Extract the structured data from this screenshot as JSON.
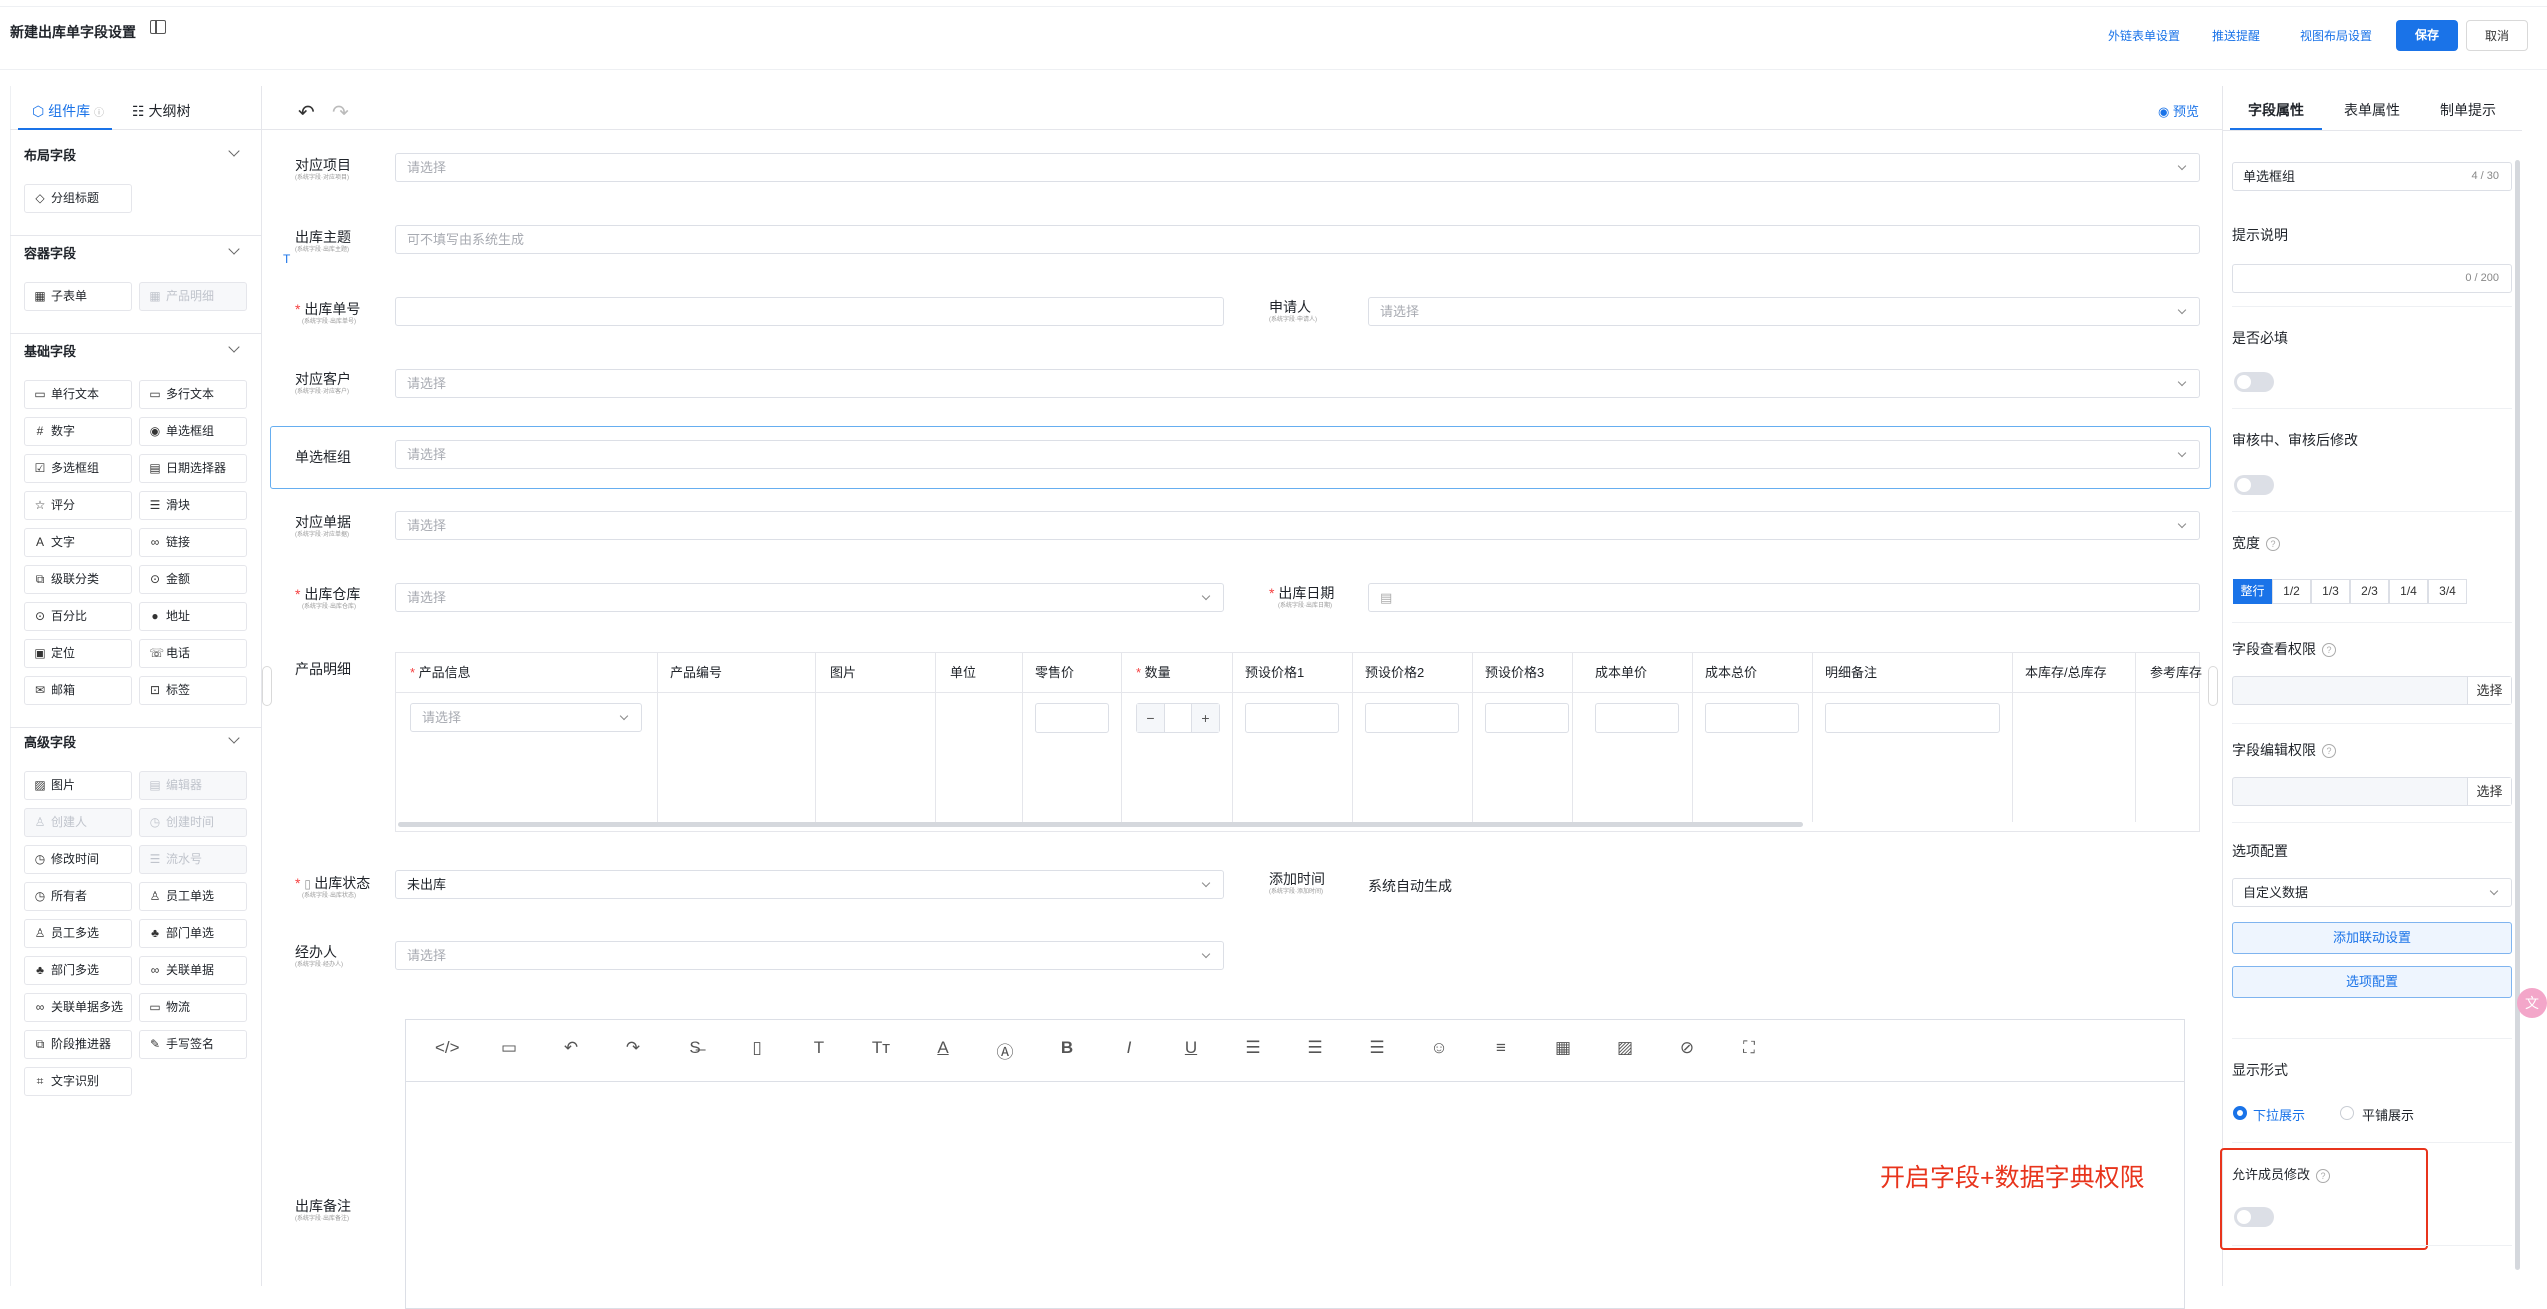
{
  "header": {
    "title": "新建出库单字段设置",
    "links": [
      "外链表单设置",
      "推送提醒",
      "视图布局设置"
    ],
    "save_label": "保存",
    "cancel_label": "取消"
  },
  "left_panel": {
    "tabs": [
      "组件库",
      "大纲树"
    ],
    "sections": [
      {
        "title": "布局字段",
        "items": [
          {
            "label": "分组标题",
            "icon": "◇",
            "disabled": false
          }
        ]
      },
      {
        "title": "容器字段",
        "items": [
          {
            "label": "子表单",
            "icon": "▦",
            "disabled": false
          },
          {
            "label": "产品明细",
            "icon": "▦",
            "disabled": true
          }
        ]
      },
      {
        "title": "基础字段",
        "items": [
          {
            "label": "单行文本",
            "icon": "▭",
            "disabled": false
          },
          {
            "label": "多行文本",
            "icon": "▭",
            "disabled": false
          },
          {
            "label": "数字",
            "icon": "#",
            "disabled": false
          },
          {
            "label": "单选框组",
            "icon": "◉",
            "disabled": false
          },
          {
            "label": "多选框组",
            "icon": "☑",
            "disabled": false
          },
          {
            "label": "日期选择器",
            "icon": "▤",
            "disabled": false
          },
          {
            "label": "评分",
            "icon": "☆",
            "disabled": false
          },
          {
            "label": "滑块",
            "icon": "☰",
            "disabled": false
          },
          {
            "label": "文字",
            "icon": "A",
            "disabled": false
          },
          {
            "label": "链接",
            "icon": "∞",
            "disabled": false
          },
          {
            "label": "级联分类",
            "icon": "⧉",
            "disabled": false
          },
          {
            "label": "金额",
            "icon": "⊙",
            "disabled": false
          },
          {
            "label": "百分比",
            "icon": "⊙",
            "disabled": false
          },
          {
            "label": "地址",
            "icon": "●",
            "disabled": false
          },
          {
            "label": "定位",
            "icon": "▣",
            "disabled": false
          },
          {
            "label": "电话",
            "icon": "☏",
            "disabled": false
          },
          {
            "label": "邮箱",
            "icon": "✉",
            "disabled": false
          },
          {
            "label": "标签",
            "icon": "⊡",
            "disabled": false
          }
        ]
      },
      {
        "title": "高级字段",
        "items": [
          {
            "label": "图片",
            "icon": "▨",
            "disabled": false
          },
          {
            "label": "编辑器",
            "icon": "▤",
            "disabled": true
          },
          {
            "label": "创建人",
            "icon": "♙",
            "disabled": true
          },
          {
            "label": "创建时间",
            "icon": "◷",
            "disabled": true
          },
          {
            "label": "修改时间",
            "icon": "◷",
            "disabled": false
          },
          {
            "label": "流水号",
            "icon": "☰",
            "disabled": true
          },
          {
            "label": "所有者",
            "icon": "◷",
            "disabled": false
          },
          {
            "label": "员工单选",
            "icon": "♙",
            "disabled": false
          },
          {
            "label": "员工多选",
            "icon": "♙",
            "disabled": false
          },
          {
            "label": "部门单选",
            "icon": "♣",
            "disabled": false
          },
          {
            "label": "部门多选",
            "icon": "♣",
            "disabled": false
          },
          {
            "label": "关联单据",
            "icon": "∞",
            "disabled": false
          },
          {
            "label": "关联单据多选",
            "icon": "∞",
            "disabled": false
          },
          {
            "label": "物流",
            "icon": "▭",
            "disabled": false
          },
          {
            "label": "阶段推进器",
            "icon": "⧉",
            "disabled": false
          },
          {
            "label": "手写签名",
            "icon": "✎",
            "disabled": false
          },
          {
            "label": "文字识别",
            "icon": "⌗",
            "disabled": false
          }
        ]
      }
    ]
  },
  "canvas": {
    "preview_label": "预览",
    "placeholder_select": "请选择",
    "fields": {
      "item": {
        "label": "对应项目",
        "sub": "(系统字段·对应项目)"
      },
      "subject": {
        "label": "出库主题",
        "sub": "(系统字段·出库主题)",
        "placeholder": "可不填写由系统生成"
      },
      "no": {
        "label": "出库单号",
        "sub": "(系统字段·出库单号)"
      },
      "applicant": {
        "label": "申请人",
        "sub": "(系统字段·申请人)"
      },
      "customer": {
        "label": "对应客户",
        "sub": "(系统字段·对应客户)"
      },
      "radio_group": {
        "label": "单选框组"
      },
      "order": {
        "label": "对应单据",
        "sub": "(系统字段·对应单据)"
      },
      "warehouse": {
        "label": "出库仓库",
        "sub": "(系统字段·出库仓库)"
      },
      "date": {
        "label": "出库日期",
        "sub": "(系统字段·出库日期)"
      },
      "products": {
        "label": "产品明细"
      },
      "status": {
        "label": "出库状态",
        "sub": "(系统字段·出库状态)",
        "value": "未出库"
      },
      "add_time": {
        "label": "添加时间",
        "sub": "(系统字段·添加时间)",
        "value": "系统自动生成"
      },
      "handler": {
        "label": "经办人",
        "sub": "(系统字段·经办人)"
      },
      "remark": {
        "label": "出库备注",
        "sub": "(系统字段·出库备注)"
      }
    },
    "table_columns": [
      "产品信息",
      "产品编号",
      "图片",
      "单位",
      "零售价",
      "数量",
      "预设价格1",
      "预设价格2",
      "预设价格3",
      "成本单价",
      "成本总价",
      "明细备注",
      "本库存/总库存",
      "参考库存"
    ],
    "qty_minus": "−",
    "qty_plus": "+",
    "annotation": "开启字段+数据字典权限"
  },
  "right_panel": {
    "tabs": [
      "字段属性",
      "表单属性",
      "制单提示"
    ],
    "title_value": "单选框组",
    "title_count": "4 / 30",
    "hint_label": "提示说明",
    "hint_count": "0 / 200",
    "required_label": "是否必填",
    "edit_label": "审核中、审核后修改",
    "width_label": "宽度",
    "width_options": [
      "整行",
      "1/2",
      "1/3",
      "2/3",
      "1/4",
      "3/4"
    ],
    "view_perm_label": "字段查看权限",
    "edit_perm_label": "字段编辑权限",
    "select_label": "选择",
    "option_config_label": "选项配置",
    "option_source": "自定义数据",
    "add_link_label": "添加联动设置",
    "option_btn_label": "选项配置",
    "display_label": "显示形式",
    "display_options": [
      "下拉展示",
      "平铺展示"
    ],
    "member_edit_label": "允许成员修改"
  }
}
